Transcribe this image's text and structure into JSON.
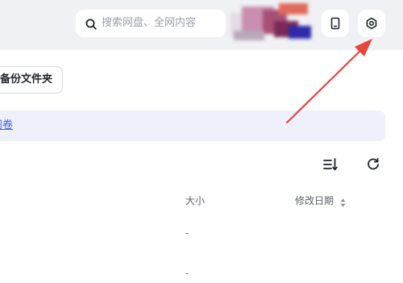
{
  "search": {
    "placeholder": "搜索网盘、全网内容"
  },
  "toolbar": {
    "backup_folder_label": "备份文件夹"
  },
  "banner": {
    "link_text": "问卷"
  },
  "table": {
    "columns": [
      "大小",
      "修改日期"
    ],
    "rows": [
      {
        "size": "-"
      },
      {
        "size": "-"
      }
    ]
  },
  "colors": {
    "accent": "#3a5dfc",
    "annotation_arrow": "#e8453c"
  },
  "icons": {
    "search": "search-icon",
    "device": "phone-icon",
    "settings": "gear-icon",
    "sort": "sort-list-icon",
    "refresh": "refresh-icon"
  }
}
